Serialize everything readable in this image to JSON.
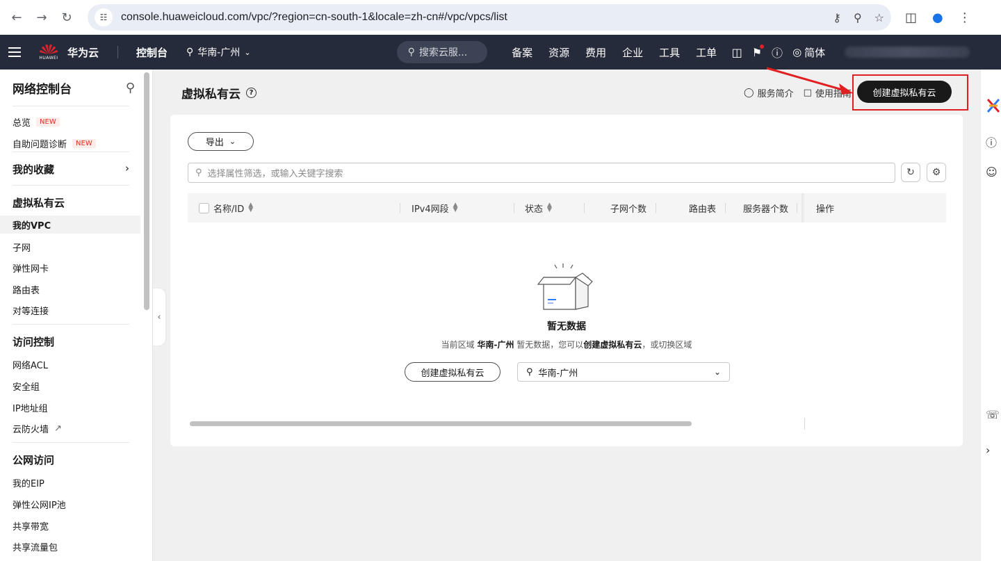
{
  "browser": {
    "url": "console.huaweicloud.com/vpc/?region=cn-south-1&locale=zh-cn#/vpc/vpcs/list"
  },
  "topnav": {
    "logo_small": "HUAWEI",
    "brand": "华为云",
    "console": "控制台",
    "region": "华南-广州",
    "search_placeholder": "搜索云服...",
    "menu": [
      "备案",
      "资源",
      "费用",
      "企业",
      "工具",
      "工单"
    ],
    "lang": "简体"
  },
  "sidebar": {
    "title": "网络控制台",
    "new_badge": "NEW",
    "overview": "总览",
    "diagnosis": "自助问题诊断",
    "favorites": "我的收藏",
    "sections": {
      "vpc": "虚拟私有云",
      "access": "访问控制",
      "public": "公网访问"
    },
    "vpc_items": [
      "我的VPC",
      "子网",
      "弹性网卡",
      "路由表",
      "对等连接"
    ],
    "access_items": [
      "网络ACL",
      "安全组",
      "IP地址组",
      "云防火墙"
    ],
    "public_items": [
      "我的EIP",
      "弹性公网IP池",
      "共享带宽",
      "共享流量包"
    ]
  },
  "header": {
    "title": "虚拟私有云",
    "service_intro": "服务简介",
    "guide": "使用指南",
    "create_button": "创建虚拟私有云"
  },
  "toolbar": {
    "export": "导出",
    "filter_placeholder": "选择属性筛选，或输入关键字搜索"
  },
  "table": {
    "columns": [
      "名称/ID",
      "IPv4网段",
      "状态",
      "子网个数",
      "路由表",
      "服务器个数",
      "操作"
    ]
  },
  "empty": {
    "title": "暂无数据",
    "desc_prefix": "当前区域",
    "desc_region": "华南-广州",
    "desc_middle": "暂无数据，您可以",
    "desc_action": "创建虚拟私有云",
    "desc_suffix": "，或切换区域",
    "create_button": "创建虚拟私有云",
    "region_select": "华南-广州"
  },
  "colors": {
    "topnav_bg": "#252b3a",
    "primary_button": "#191919",
    "annotation_red": "#e02020"
  }
}
